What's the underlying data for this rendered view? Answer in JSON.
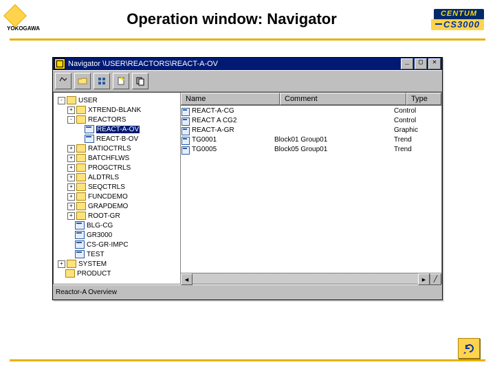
{
  "slide": {
    "title": "Operation window: Navigator",
    "vendor": "YOKOGAWA",
    "logo_top": "CENTUM",
    "logo_bottom": "CS3000"
  },
  "window": {
    "title": "Navigator \\USER\\REACTORS\\REACT-A-OV",
    "btn_min": "_",
    "btn_max": "▢",
    "btn_close": "✕",
    "statusbar": "Reactor-A Overview"
  },
  "tree": [
    {
      "depth": 0,
      "plus": "-",
      "folder": true,
      "text": "USER"
    },
    {
      "depth": 1,
      "plus": "+",
      "folder": true,
      "text": "XTREND-BLANK"
    },
    {
      "depth": 1,
      "plus": "-",
      "folder": true,
      "text": "REACTORS"
    },
    {
      "depth": 2,
      "plus": "",
      "folder": false,
      "text": "REACT-A-OV",
      "selected": true
    },
    {
      "depth": 2,
      "plus": "",
      "folder": false,
      "text": "REACT-B-OV"
    },
    {
      "depth": 1,
      "plus": "+",
      "folder": true,
      "text": "RATIOCTRLS"
    },
    {
      "depth": 1,
      "plus": "+",
      "folder": true,
      "text": "BATCHFLWS"
    },
    {
      "depth": 1,
      "plus": "+",
      "folder": true,
      "text": "PROGCTRLS"
    },
    {
      "depth": 1,
      "plus": "+",
      "folder": true,
      "text": "ALDTRLS"
    },
    {
      "depth": 1,
      "plus": "+",
      "folder": true,
      "text": "SEQCTRLS"
    },
    {
      "depth": 1,
      "plus": "+",
      "folder": true,
      "text": "FUNCDEMO"
    },
    {
      "depth": 1,
      "plus": "+",
      "folder": true,
      "text": "GRAPDEMO"
    },
    {
      "depth": 1,
      "plus": "+",
      "folder": true,
      "text": "ROOT-GR"
    },
    {
      "depth": 1,
      "plus": "",
      "folder": false,
      "text": "BLG-CG"
    },
    {
      "depth": 1,
      "plus": "",
      "folder": false,
      "text": "GR3000"
    },
    {
      "depth": 1,
      "plus": "",
      "folder": false,
      "text": "CS-GR-IMPC"
    },
    {
      "depth": 1,
      "plus": "",
      "folder": false,
      "text": "TEST"
    },
    {
      "depth": 0,
      "plus": "+",
      "folder": true,
      "text": "SYSTEM"
    },
    {
      "depth": 0,
      "plus": "",
      "folder": true,
      "text": "PRODUCT"
    }
  ],
  "columns": {
    "name": "Name",
    "comment": "Comment",
    "type": "Type"
  },
  "rows": [
    {
      "name": "REACT-A-CG",
      "comment": "",
      "type": "Control"
    },
    {
      "name": "REACT A CG2",
      "comment": "",
      "type": "Control"
    },
    {
      "name": "REACT-A-GR",
      "comment": "",
      "type": "Graphic"
    },
    {
      "name": "TG0001",
      "comment": "Block01 Group01",
      "type": "Trend"
    },
    {
      "name": "TG0005",
      "comment": "Block05 Group01",
      "type": "Trend"
    }
  ]
}
